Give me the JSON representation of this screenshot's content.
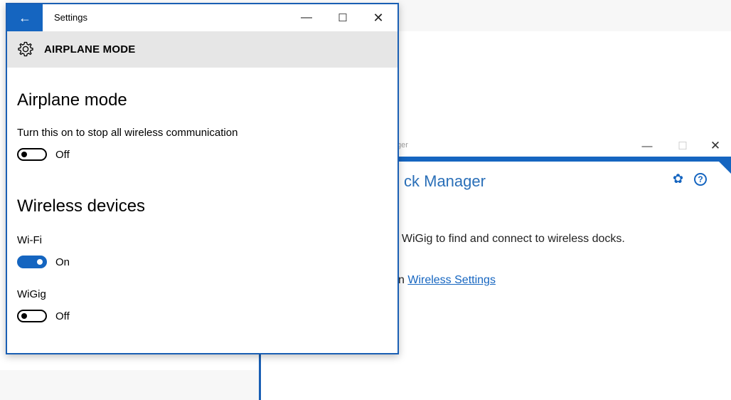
{
  "settings_window": {
    "title": "Settings",
    "back_icon": "back-arrow-icon",
    "controls": {
      "minimize": "—",
      "maximize": "☐",
      "close": "✕"
    },
    "header": {
      "icon": "gear-icon",
      "title": "AIRPLANE MODE"
    },
    "airplane_section": {
      "title": "Airplane mode",
      "description": "Turn this on to stop all wireless communication",
      "toggle_state": "Off",
      "toggle_on": false
    },
    "wireless_section": {
      "title": "Wireless devices",
      "wifi": {
        "label": "Wi-Fi",
        "state": "On",
        "on": true
      },
      "wigig": {
        "label": "WiGig",
        "state": "Off",
        "on": false
      }
    }
  },
  "dock_window": {
    "title_fragment": "ger",
    "controls": {
      "minimize": "—",
      "maximize": "☐",
      "close": "✕"
    },
    "heading": "ck Manager",
    "settings_icon": "gear-icon",
    "help_icon": "help-circle-icon",
    "help_glyph": "?",
    "description": ". WiGig to find and connect to wireless docks.",
    "link_prefix": "n ",
    "link_text": "Wireless Settings"
  },
  "colors": {
    "accent": "#1565c0",
    "header_band": "#e6e6e6"
  }
}
